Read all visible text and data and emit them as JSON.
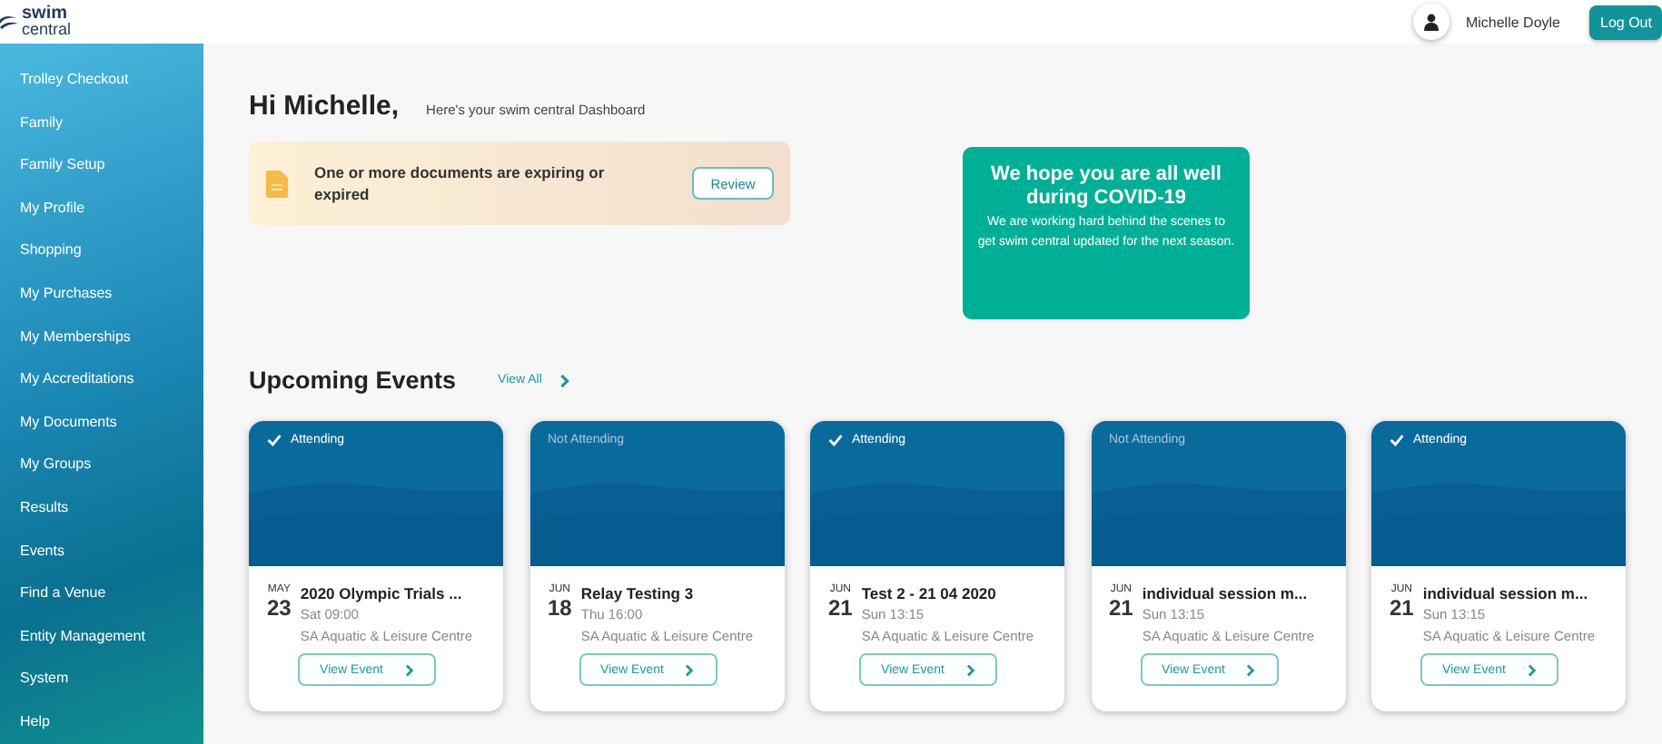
{
  "header": {
    "logo_top": "swim",
    "logo_bottom": "central",
    "user_name": "Michelle Doyle",
    "logout": "Log Out"
  },
  "sidebar": {
    "items": [
      {
        "label": "Trolley Checkout"
      },
      {
        "label": "Family"
      },
      {
        "label": "Family Setup"
      },
      {
        "label": "My Profile"
      },
      {
        "label": "Shopping"
      },
      {
        "label": "My Purchases"
      },
      {
        "label": "My Memberships"
      },
      {
        "label": "My Accreditations"
      },
      {
        "label": "My Documents"
      },
      {
        "label": "My Groups"
      },
      {
        "label": "Results"
      },
      {
        "label": "Events"
      },
      {
        "label": "Find a Venue"
      },
      {
        "label": "Entity Management"
      },
      {
        "label": "System"
      },
      {
        "label": "Help"
      }
    ]
  },
  "greeting": {
    "title": "Hi Michelle,",
    "subtitle": "Here's your swim central Dashboard"
  },
  "alert": {
    "message": "One or more documents are expiring or expired",
    "button": "Review"
  },
  "notice": {
    "title": "We hope you are all well during COVID-19",
    "body": "We are working hard behind the scenes to get swim central updated for the next season."
  },
  "events": {
    "title": "Upcoming Events",
    "view_all": "View All",
    "cards": [
      {
        "attending": true,
        "status": "Attending",
        "month": "MAY",
        "day": "23",
        "name": "2020 Olympic Trials ...",
        "time": "Sat 09:00",
        "venue": "SA Aquatic & Leisure Centre",
        "button": "View Event"
      },
      {
        "attending": false,
        "status": "Not Attending",
        "month": "JUN",
        "day": "18",
        "name": "Relay Testing 3",
        "time": "Thu 16:00",
        "venue": "SA Aquatic & Leisure Centre",
        "button": "View Event"
      },
      {
        "attending": true,
        "status": "Attending",
        "month": "JUN",
        "day": "21",
        "name": "Test 2 - 21 04 2020",
        "time": "Sun 13:15",
        "venue": "SA Aquatic & Leisure Centre",
        "button": "View Event"
      },
      {
        "attending": false,
        "status": "Not Attending",
        "month": "JUN",
        "day": "21",
        "name": "individual session m...",
        "time": "Sun 13:15",
        "venue": "SA Aquatic & Leisure Centre",
        "button": "View Event"
      },
      {
        "attending": true,
        "status": "Attending",
        "month": "JUN",
        "day": "21",
        "name": "individual session m...",
        "time": "Sun 13:15",
        "venue": "SA Aquatic & Leisure Centre",
        "button": "View Event"
      }
    ]
  }
}
